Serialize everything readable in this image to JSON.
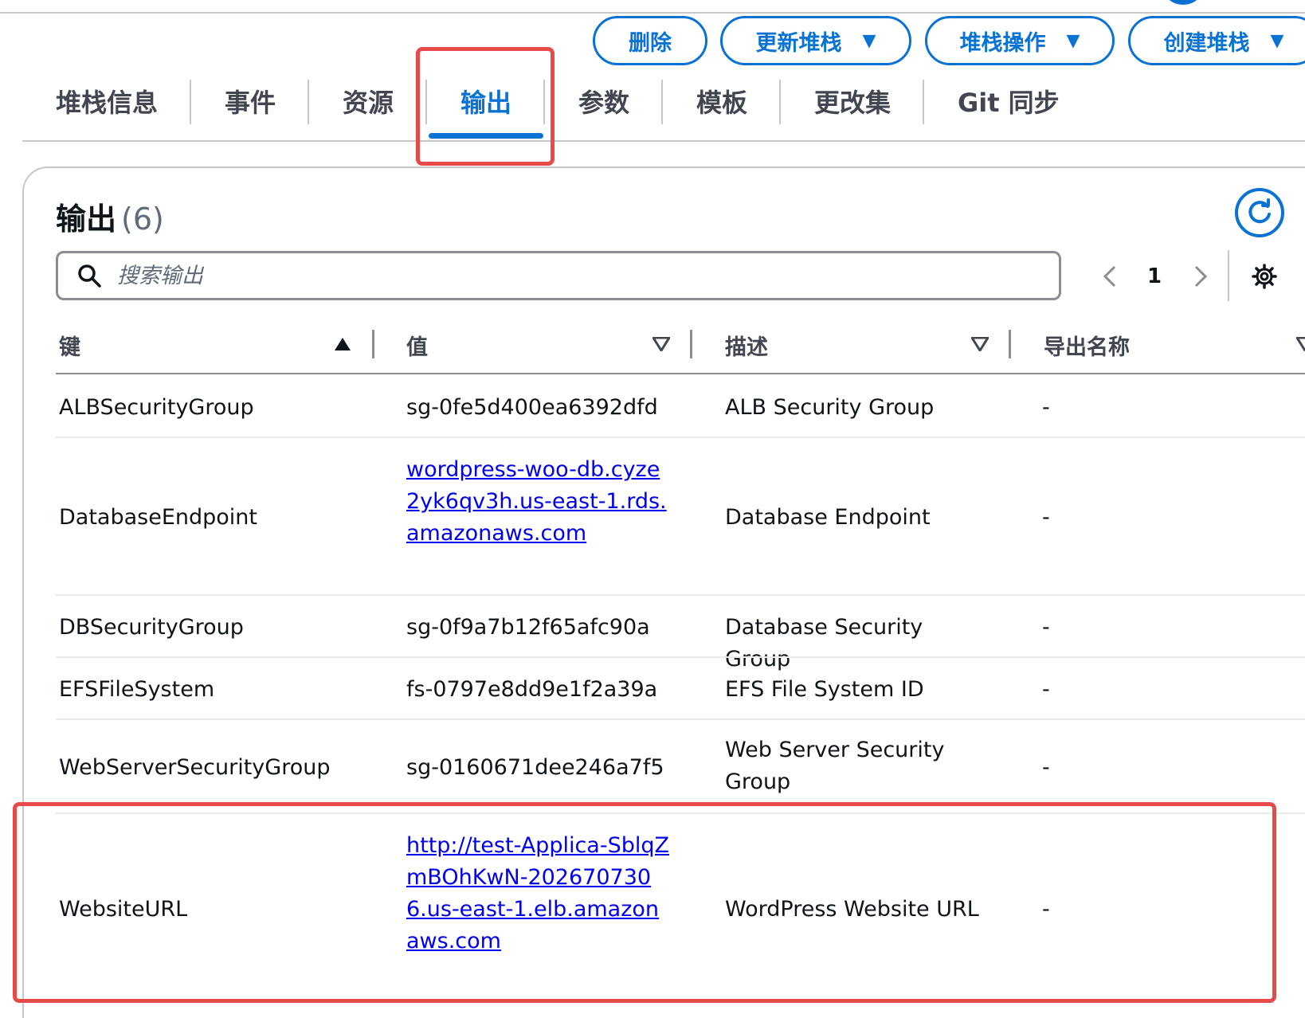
{
  "actions": {
    "delete": "删除",
    "update": "更新堆栈",
    "stack_actions": "堆栈操作",
    "create": "创建堆栈"
  },
  "tabs": [
    "堆栈信息",
    "事件",
    "资源",
    "输出",
    "参数",
    "模板",
    "更改集",
    "Git 同步"
  ],
  "active_tab": "输出",
  "outputs": {
    "title": "输出",
    "count": "(6)",
    "search_placeholder": "搜索输出",
    "page": "1"
  },
  "table": {
    "columns": [
      "键",
      "值",
      "描述",
      "导出名称"
    ],
    "rows": [
      {
        "key": "ALBSecurityGroup",
        "value": "sg-0fe5d400ea6392dfd",
        "description": "ALB Security Group",
        "export": "-"
      },
      {
        "key": "DatabaseEndpoint",
        "value": "wordpress-woo-db.cyze2yk6qv3h.us-east-1.rds.amazonaws.com",
        "description": "Database Endpoint",
        "export": "-"
      },
      {
        "key": "DBSecurityGroup",
        "value": "sg-0f9a7b12f65afc90a",
        "description": "Database Security Group",
        "export": "-"
      },
      {
        "key": "EFSFileSystem",
        "value": "fs-0797e8dd9e1f2a39a",
        "description": "EFS File System ID",
        "export": "-"
      },
      {
        "key": "WebServerSecurityGroup",
        "value": "sg-0160671dee246a7f5",
        "description": "Web Server Security Group",
        "export": "-"
      },
      {
        "key": "WebsiteURL",
        "value": "http://test-Applica-SblqZmBOhKwN-2026707306.us-east-1.elb.amazonaws.com",
        "description": "WordPress Website URL",
        "export": "-"
      }
    ]
  },
  "colors": {
    "accent": "#0972d3",
    "highlight": "#e84a4a",
    "link": "#0000ee"
  },
  "icons": [
    "search-icon",
    "refresh-icon",
    "chevron-left-icon",
    "chevron-right-icon",
    "gear-icon",
    "sort-asc-icon",
    "sort-desc-icon",
    "caret-down-icon"
  ]
}
